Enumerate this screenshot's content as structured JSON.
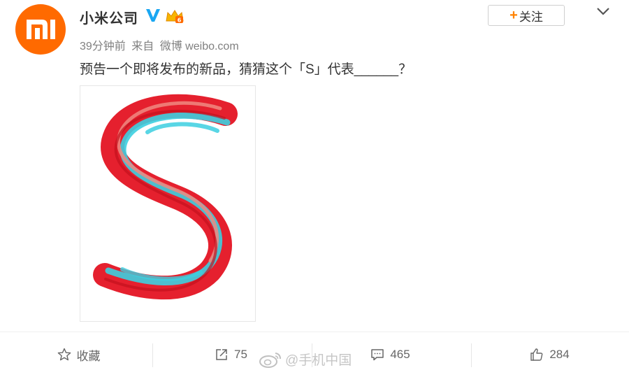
{
  "user": {
    "name": "小米公司",
    "logo_text": "mi",
    "verified_icon": "blue-verified-v-icon",
    "member_icon": "vip-crown-icon"
  },
  "meta": {
    "time": "39分钟前",
    "source_prefix": "来自",
    "source": "微博 weibo.com"
  },
  "follow_button": {
    "label": "关注",
    "icon": "plus-icon"
  },
  "post": {
    "text": "预告一个即将发布的新品，猜猜这个「S」代表______？"
  },
  "actions": {
    "favorite": {
      "label": "收藏",
      "icon": "star-icon"
    },
    "repost": {
      "count": "75",
      "icon": "share-icon"
    },
    "comment": {
      "count": "465",
      "icon": "comment-icon"
    },
    "like": {
      "count": "284",
      "icon": "thumbs-up-icon"
    }
  },
  "watermark": {
    "text": "@手机中国",
    "icon": "weibo-logo-icon"
  },
  "colors": {
    "brand_orange": "#ff6a00",
    "follow_plus": "#ff8200",
    "verified_blue": "#1aa7f2",
    "text_primary": "#333333",
    "text_secondary": "#808080",
    "s_red": "#e5202e",
    "s_cyan": "#3ccfe0"
  }
}
